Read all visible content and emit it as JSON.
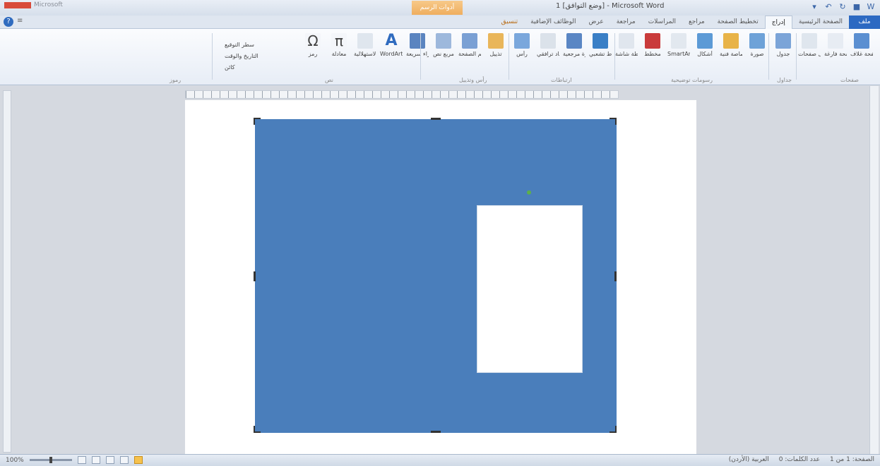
{
  "titlebar": {
    "office_label": "Microsoft",
    "context_tab": "أدوات الرسم",
    "title": "1 [وضع التوافق] - Microsoft Word"
  },
  "tabs": [
    {
      "label": "ملف",
      "kind": "file"
    },
    {
      "label": "الصفحة الرئيسية",
      "kind": "normal"
    },
    {
      "label": "إدراج",
      "kind": "active"
    },
    {
      "label": "تخطيط الصفحة",
      "kind": "normal"
    },
    {
      "label": "مراجع",
      "kind": "normal"
    },
    {
      "label": "المراسلات",
      "kind": "normal"
    },
    {
      "label": "مراجعة",
      "kind": "normal"
    },
    {
      "label": "عرض",
      "kind": "normal"
    },
    {
      "label": "الوظائف الإضافية",
      "kind": "normal"
    },
    {
      "label": "تنسيق",
      "kind": "context"
    }
  ],
  "ribbon": {
    "buttons": [
      {
        "name": "cover-page",
        "label": "صفحة غلاف",
        "color": "#5b8fd1"
      },
      {
        "name": "blank-page",
        "label": "صفحة فارغة",
        "color": "#e7ecf3"
      },
      {
        "name": "page-break",
        "label": "فاصل صفحات",
        "color": "#dfe6ee"
      },
      {
        "name": "table",
        "label": "جدول",
        "color": "#7ba4d8"
      },
      {
        "name": "picture",
        "label": "صورة",
        "color": "#6ea2d8"
      },
      {
        "name": "clip-art",
        "label": "قصاصة فنية",
        "color": "#e8b347"
      },
      {
        "name": "shapes",
        "label": "أشكال",
        "color": "#5c9ad6"
      },
      {
        "name": "smartart",
        "label": "SmartArt",
        "color": "#e2e8ef"
      },
      {
        "name": "chart",
        "label": "مخطط",
        "color": "#c93b3b"
      },
      {
        "name": "screenshot",
        "label": "لقطة شاشة",
        "color": "#e0e6ee"
      },
      {
        "name": "hyperlink",
        "label": "ارتباط تشعبي",
        "color": "#3a7fc6"
      },
      {
        "name": "bookmark",
        "label": "إشارة مرجعية",
        "color": "#5a86c4"
      },
      {
        "name": "cross-reference",
        "label": "إسناد ترافقي",
        "color": "#dbe2ea"
      },
      {
        "name": "header",
        "label": "رأس",
        "color": "#7aa7dc"
      },
      {
        "name": "footer",
        "label": "تذييل",
        "color": "#e9b65a"
      },
      {
        "name": "page-number",
        "label": "رقم الصفحة",
        "color": "#7aa0d4"
      },
      {
        "name": "text-box",
        "label": "مربع نص",
        "color": "#9db8dc"
      },
      {
        "name": "quick-parts",
        "label": "أجزاء سريعة",
        "color": "#5a84c0"
      },
      {
        "name": "wordart",
        "label": "WordArt",
        "color": "#2f6bbf"
      },
      {
        "name": "drop-cap",
        "label": "إسقاط الأحرف الاستهلالية",
        "color": "#dfe6ee"
      },
      {
        "name": "equation",
        "label": "معادلة",
        "color": "#f4f6fa"
      },
      {
        "name": "symbol",
        "label": "رمز",
        "color": "#f4f6fa"
      }
    ],
    "group_labels": [
      "صفحات",
      "جداول",
      "رسومات توضيحية",
      "ارتباطات",
      "رأس وتذييل",
      "نص",
      "رموز"
    ],
    "signature_line": "سطر التوقيع",
    "date_time": "التاريخ والوقت",
    "object": "كائن",
    "equation_glyph": "π",
    "symbol_glyph": "Ω"
  },
  "status": {
    "page": "الصفحة: 1 من 1",
    "words": "عدد الكلمات: 0",
    "language": "العربية (الأردن)",
    "zoom": "100%"
  },
  "colors": {
    "shape_fill": "#4a7ebb",
    "file_tab": "#2c69c2",
    "context_tab": "#efae5e"
  }
}
